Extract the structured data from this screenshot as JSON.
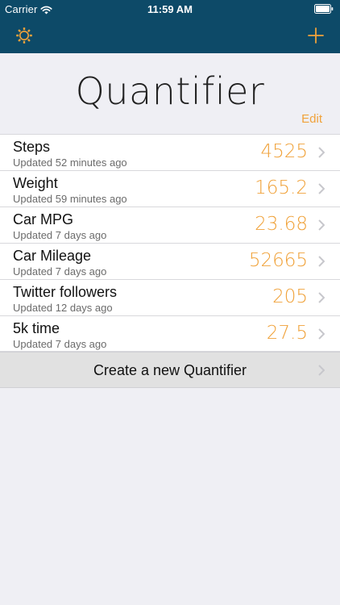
{
  "status_bar": {
    "carrier": "Carrier",
    "time": "11:59 AM"
  },
  "nav": {
    "left_icon": "gear-icon",
    "right_icon": "plus-icon"
  },
  "header": {
    "title": "Quantifier",
    "edit_label": "Edit"
  },
  "colors": {
    "nav_background": "#0d4a68",
    "accent": "#f0a23a",
    "background": "#efeff4"
  },
  "quantifiers": [
    {
      "name": "Steps",
      "updated": "Updated 52 minutes ago",
      "value": "4525"
    },
    {
      "name": "Weight",
      "updated": "Updated 59 minutes ago",
      "value": "165.2"
    },
    {
      "name": "Car MPG",
      "updated": "Updated 7 days ago",
      "value": "23.68"
    },
    {
      "name": "Car Mileage",
      "updated": "Updated 7 days ago",
      "value": "52665"
    },
    {
      "name": "Twitter followers",
      "updated": "Updated 12 days ago",
      "value": "205"
    },
    {
      "name": "5k time",
      "updated": "Updated 7 days ago",
      "value": "27.5"
    }
  ],
  "create": {
    "label": "Create a new Quantifier"
  }
}
